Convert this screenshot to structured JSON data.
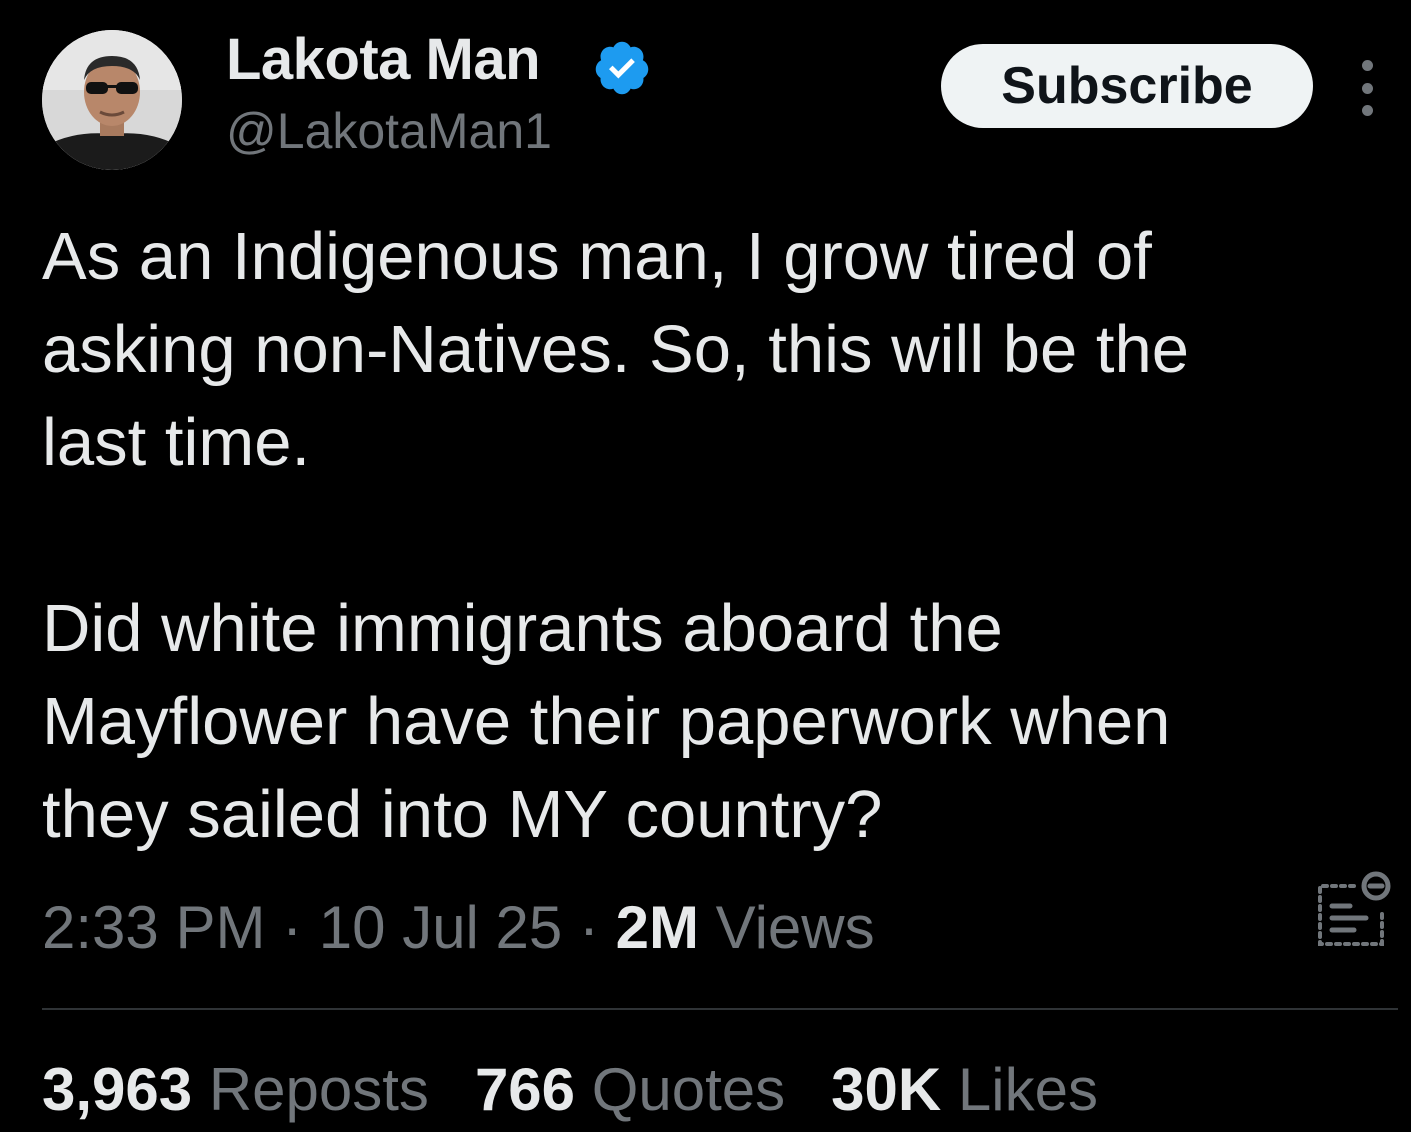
{
  "author": {
    "display_name": "Lakota Man",
    "handle": "@LakotaMan1",
    "verified_icon": "verified-badge-icon",
    "verified_color": "#1d9bf0"
  },
  "header": {
    "subscribe_label": "Subscribe",
    "more_icon": "more-options-icon"
  },
  "tweet": {
    "text_paragraph_1": "As an Indigenous man, I grow tired of\nasking non-Natives. So, this will be the\nlast time.",
    "text_paragraph_2": "Did white immigrants aboard the\nMayflower have their paperwork when\nthey sailed into MY country?"
  },
  "meta": {
    "time": "2:33 PM",
    "separator": " · ",
    "date": "10 Jul 25",
    "views_count": "2M",
    "views_label": "Views",
    "analytics_icon": "analytics-icon"
  },
  "stats": {
    "reposts_count": "3,963",
    "reposts_label": "Reposts",
    "quotes_count": "766",
    "quotes_label": "Quotes",
    "likes_count": "30K",
    "likes_label": "Likes"
  },
  "colors": {
    "background": "#000000",
    "primary_text": "#e7e9ea",
    "secondary_text": "#71767b",
    "divider": "#2f3336",
    "button_bg": "#eff3f4"
  }
}
